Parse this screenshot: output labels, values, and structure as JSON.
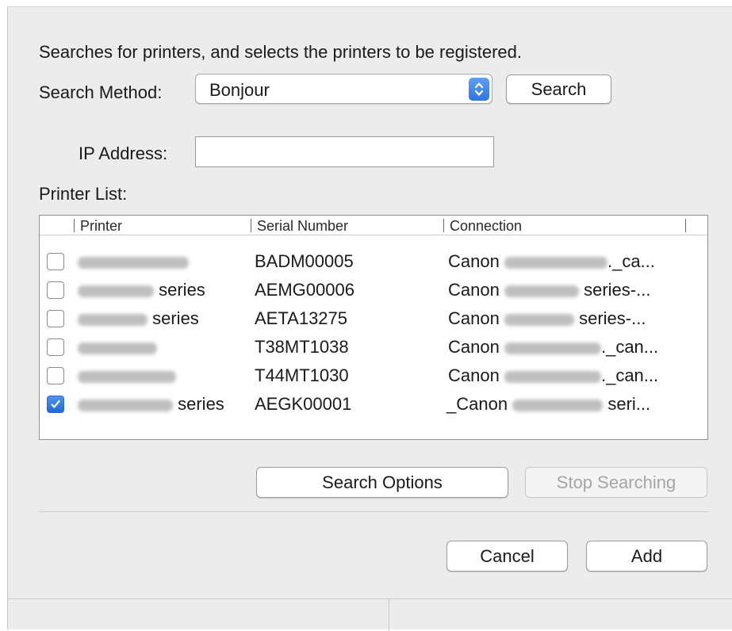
{
  "dialog": {
    "description": "Searches for printers, and selects the printers to be registered."
  },
  "search_method": {
    "label": "Search Method:",
    "selected": "Bonjour"
  },
  "buttons": {
    "search": "Search",
    "search_options": "Search Options",
    "stop_searching": "Stop Searching",
    "cancel": "Cancel",
    "add": "Add"
  },
  "ip_address": {
    "label": "IP Address:",
    "value": ""
  },
  "printer_list": {
    "label": "Printer List:",
    "columns": [
      "Printer",
      "Serial Number",
      "Connection"
    ],
    "rows": [
      {
        "checked": false,
        "printer_suffix": "",
        "serial": "BADM00005",
        "conn_prefix": "Canon",
        "conn_suffix": "._ca..."
      },
      {
        "checked": false,
        "printer_suffix": "series",
        "serial": "AEMG00006",
        "conn_prefix": "Canon",
        "conn_suffix": "series-..."
      },
      {
        "checked": false,
        "printer_suffix": "series",
        "serial": "AETA13275",
        "conn_prefix": "Canon",
        "conn_suffix": "series-..."
      },
      {
        "checked": false,
        "printer_suffix": "",
        "serial": "T38MT1038",
        "conn_prefix": "Canon",
        "conn_suffix": "._can..."
      },
      {
        "checked": false,
        "printer_suffix": "",
        "serial": "T44MT1030",
        "conn_prefix": "Canon",
        "conn_suffix": "._can..."
      },
      {
        "checked": true,
        "printer_suffix": "series",
        "serial": "AEGK00001",
        "conn_prefix": "_Canon",
        "conn_suffix": "seri..."
      }
    ]
  },
  "colors": {
    "accent": "#2d76e0",
    "dialog_background": "#ececec",
    "disabled_text": "#a5a5a5"
  }
}
